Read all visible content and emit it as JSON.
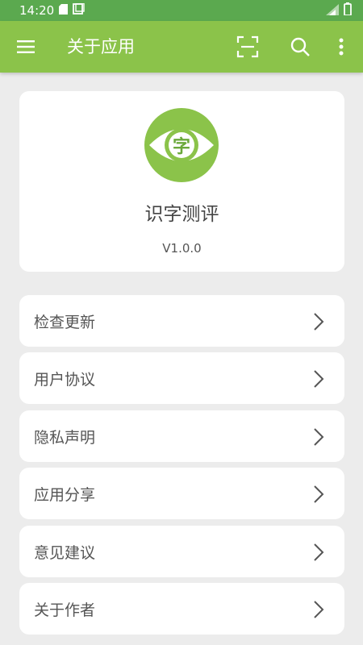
{
  "status_bar": {
    "time": "14:20"
  },
  "app_bar": {
    "title": "关于应用"
  },
  "about": {
    "app_name": "识字测评",
    "version": "V1.0.0",
    "logo_char": "字"
  },
  "colors": {
    "primary": "#8bc34a",
    "status_bar": "#5ba94f",
    "background": "#ececec"
  },
  "menu": [
    {
      "label": "检查更新"
    },
    {
      "label": "用户协议"
    },
    {
      "label": "隐私声明"
    },
    {
      "label": "应用分享"
    },
    {
      "label": "意见建议"
    },
    {
      "label": "关于作者"
    }
  ]
}
